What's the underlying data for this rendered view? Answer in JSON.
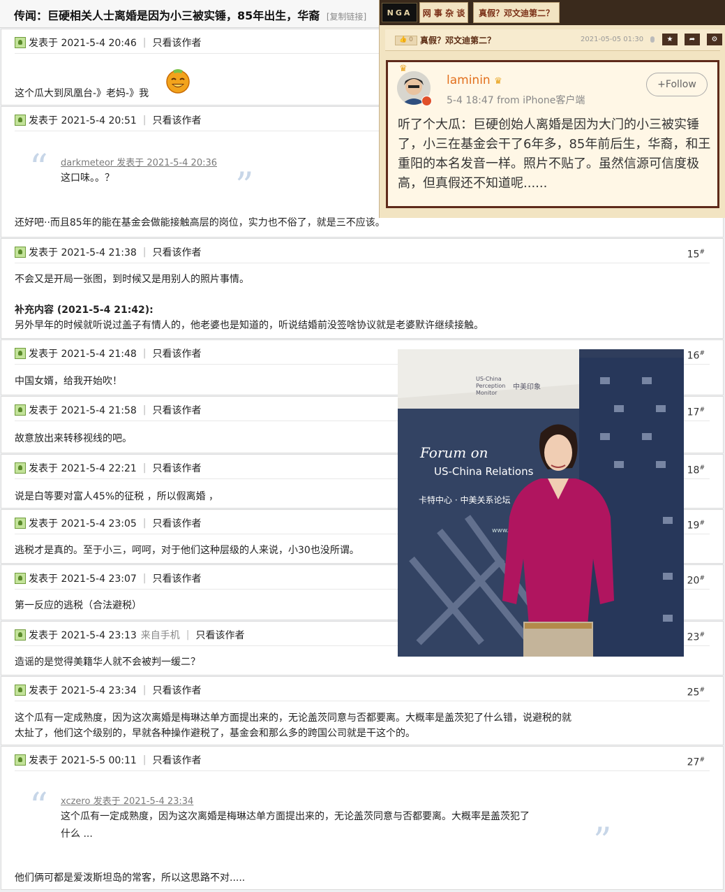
{
  "topic": {
    "title": "传闻：巨硬相关人士离婚是因为小三被实锤，85年出生，华裔",
    "copy_link": "[复制链接]"
  },
  "posts": [
    {
      "time": "发表于 2021-5-4 20:46",
      "only_author": "只看该作者",
      "floor": "",
      "body": "这个瓜大到凤凰台-》老妈-》我"
    },
    {
      "time": "发表于 2021-5-4 20:51",
      "only_author": "只看该作者",
      "floor": "",
      "quote_head": "darkmeteor 发表于 2021-5-4 20:36",
      "quote_text": "这口味。。？",
      "body": "还好吧··而且85年的能在基金会做能接触高层的岗位，实力也不俗了，就是三不应该。"
    },
    {
      "time": "发表于 2021-5-4 21:38",
      "only_author": "只看该作者",
      "floor": "15",
      "body": "不会又是开局一张图，到时候又是用别人的照片事情。",
      "supp_head": "补充内容 (2021-5-4 21:42):",
      "supp_text": "另外早年的时候就听说过盖子有情人的，他老婆也是知道的，听说结婚前没签啥协议就是老婆默许继续接触。"
    },
    {
      "time": "发表于 2021-5-4 21:48",
      "only_author": "只看该作者",
      "floor": "16",
      "body": "中国女婿，给我开始吹！"
    },
    {
      "time": "发表于 2021-5-4 21:58",
      "only_author": "只看该作者",
      "floor": "17",
      "body": "故意放出来转移视线的吧。"
    },
    {
      "time": "发表于 2021-5-4 22:21",
      "only_author": "只看该作者",
      "floor": "18",
      "body": "说是白等要对富人45%的征税 ，所以假离婚 ，"
    },
    {
      "time": "发表于 2021-5-4 23:05",
      "only_author": "只看该作者",
      "floor": "19",
      "body": "逃税才是真的。至于小三，呵呵，对于他们这种层级的人来说，小30也没所谓。"
    },
    {
      "time": "发表于 2021-5-4 23:07",
      "only_author": "只看该作者",
      "floor": "20",
      "body": "第一反应的逃税（合法避税）"
    },
    {
      "time": "发表于 2021-5-4 23:13",
      "device": "来自手机",
      "only_author": "只看该作者",
      "floor": "23",
      "body": "造谣的是觉得美籍华人就不会被判一缓二？"
    },
    {
      "time": "发表于 2021-5-4 23:34",
      "only_author": "只看该作者",
      "floor": "25",
      "body1": "这个瓜有一定成熟度，因为这次离婚是梅琳达单方面提出来的，无论盖茨同意与否都要离。大概率是盖茨犯了什么错，说避税的就",
      "body2": "太扯了，他们这个级别的，早就各种操作避税了，基金会和那么多的跨国公司就是干这个的。"
    },
    {
      "time": "发表于 2021-5-5 00:11",
      "only_author": "只看该作者",
      "floor": "27",
      "quote_head": "xczero 发表于 2021-5-4 23:34",
      "quote_text1": "这个瓜有一定成熟度，因为这次离婚是梅琳达单方面提出来的，无论盖茨同意与否都要离。大概率是盖茨犯了",
      "quote_text2": "什么 ...",
      "body": "他们俩可都是爱泼斯坦岛的常客，所以这思路不对....."
    }
  ],
  "nga": {
    "logo": "NGA",
    "tab1": "网 事 杂 谈",
    "tab2": "真假？邓文迪第二？",
    "sub_thumb": "👍 0",
    "sub_title": "真假？邓文迪第二？",
    "sub_date": "2021-05-05 01:30",
    "btn1": "★",
    "btn2": "➦",
    "btn3": "⚙"
  },
  "weibo": {
    "user": "laminin",
    "time": "5-4 18:47  from iPhone客户端",
    "follow": "+Follow",
    "text": "听了个大瓜：巨硬创始人离婚是因为大门的小三被实锤了，小三在基金会干了6年多，85年前后生，华裔，和王重阳的本名发音一样。照片不贴了。虽然信源可信度极高，但真假还不知道呢......"
  },
  "photo": {
    "forum_line1": "Forum on",
    "forum_line2": "US-China Relations",
    "cn_line": "卡特中心 · 中美关系论坛",
    "logo_en1": "US-China",
    "logo_en2": "Perception",
    "logo_en3": "Monitor",
    "logo_cn": "中美印象",
    "url": "www."
  },
  "colors": {
    "accent": "#7a2f16",
    "nga_bg": "#f2e4c2",
    "weibo_name": "#e2701e"
  }
}
